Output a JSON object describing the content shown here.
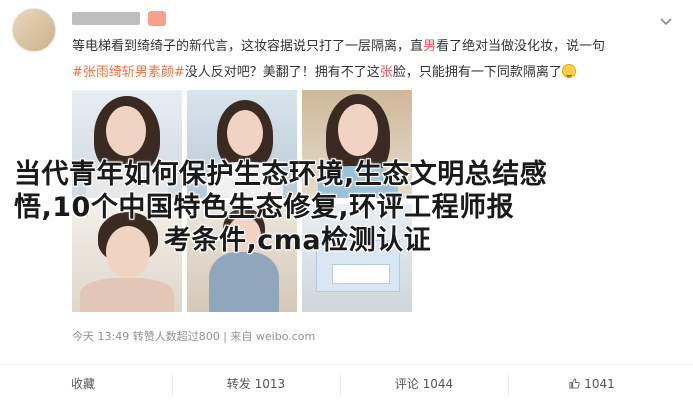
{
  "post": {
    "line1": "等电梯看到绮绮子的新代言，这妆容据说只打了一层隔离，直",
    "line1_hl": "男",
    "line1_rest": "看了绝对当做没化妆，说一句",
    "topic": "#张雨绮斩男素颜#",
    "line2_a": "没人反对吧？美翻了！拥有不了这",
    "line2_hl": "张",
    "line2_b": "脸，只能拥有一下同款隔离了"
  },
  "overlay": {
    "line1": "当代青年如何保护生态环境,生态文明总结感",
    "line2": "悟,10个中国特色生态修复,环评工程师报",
    "line3": "考条件,cma检测认证"
  },
  "meta": {
    "time": "今天 13:49",
    "source": "转赞人数超过800",
    "sep": "|",
    "via": "来自 weibo.com"
  },
  "toolbar": {
    "collect": "收藏",
    "repost_label": "转发",
    "repost_count": "1013",
    "comment_label": "评论",
    "comment_count": "1044",
    "like_count": "1041"
  },
  "icons": {
    "chevron": "chevron-down-icon",
    "emoji": "laughing-emoji-icon",
    "like": "thumbs-up-icon"
  },
  "colors": {
    "topic": "#eb7340",
    "highlight": "#e85050",
    "meta": "#909090"
  }
}
